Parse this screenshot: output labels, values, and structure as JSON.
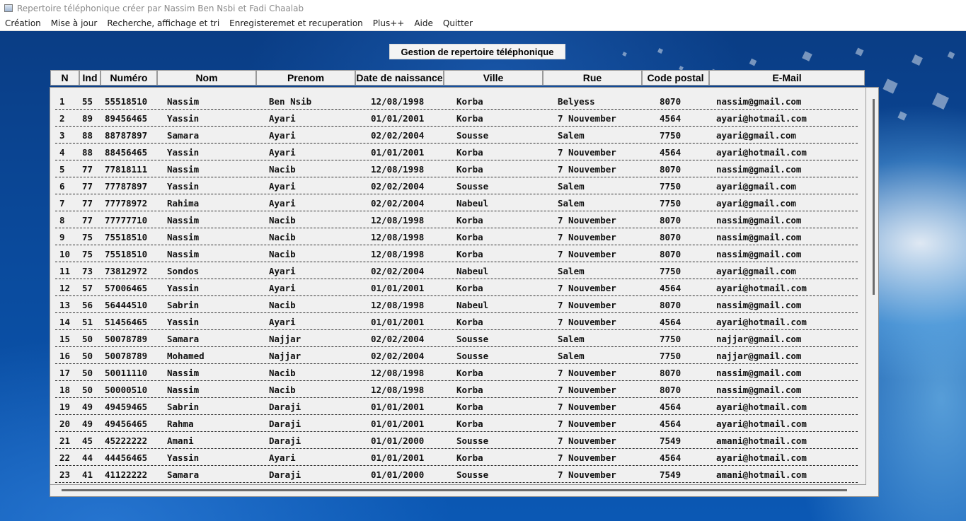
{
  "window": {
    "title": "Repertoire téléphonique créer par Nassim Ben Nsbi et Fadi Chaalab"
  },
  "menu": [
    "Création",
    "Mise à jour",
    "Recherche, affichage et tri",
    "Enregisteremet et recuperation",
    "Plus++",
    "Aide",
    "Quitter"
  ],
  "table_title": "Gestion de repertoire téléphonique",
  "columns": [
    "N",
    "Ind",
    "Numéro",
    "Nom",
    "Prenom",
    "Date de naissance",
    "Ville",
    "Rue",
    "Code postal",
    "E-Mail"
  ],
  "rows": [
    [
      "1",
      "55",
      "55518510",
      "Nassim",
      "Ben Nsib",
      "12/08/1998",
      "Korba",
      "Belyess",
      "8070",
      "nassim@gmail.com"
    ],
    [
      "2",
      "89",
      "89456465",
      "Yassin",
      "Ayari",
      "01/01/2001",
      "Korba",
      "7 Nouvember",
      "4564",
      "ayari@hotmail.com"
    ],
    [
      "3",
      "88",
      "88787897",
      "Samara",
      "Ayari",
      "02/02/2004",
      "Sousse",
      "Salem",
      "7750",
      "ayari@gmail.com"
    ],
    [
      "4",
      "88",
      "88456465",
      "Yassin",
      "Ayari",
      "01/01/2001",
      "Korba",
      "7 Nouvember",
      "4564",
      "ayari@hotmail.com"
    ],
    [
      "5",
      "77",
      "77818111",
      "Nassim",
      "Nacib",
      "12/08/1998",
      "Korba",
      "7 Nouvember",
      "8070",
      "nassim@gmail.com"
    ],
    [
      "6",
      "77",
      "77787897",
      "Yassin",
      "Ayari",
      "02/02/2004",
      "Sousse",
      "Salem",
      "7750",
      "ayari@gmail.com"
    ],
    [
      "7",
      "77",
      "77778972",
      "Rahima",
      "Ayari",
      "02/02/2004",
      "Nabeul",
      "Salem",
      "7750",
      "ayari@gmail.com"
    ],
    [
      "8",
      "77",
      "77777710",
      "Nassim",
      "Nacib",
      "12/08/1998",
      "Korba",
      "7 Nouvember",
      "8070",
      "nassim@gmail.com"
    ],
    [
      "9",
      "75",
      "75518510",
      "Nassim",
      "Nacib",
      "12/08/1998",
      "Korba",
      "7 Nouvember",
      "8070",
      "nassim@gmail.com"
    ],
    [
      "10",
      "75",
      "75518510",
      "Nassim",
      "Nacib",
      "12/08/1998",
      "Korba",
      "7 Nouvember",
      "8070",
      "nassim@gmail.com"
    ],
    [
      "11",
      "73",
      "73812972",
      "Sondos",
      "Ayari",
      "02/02/2004",
      "Nabeul",
      "Salem",
      "7750",
      "ayari@gmail.com"
    ],
    [
      "12",
      "57",
      "57006465",
      "Yassin",
      "Ayari",
      "01/01/2001",
      "Korba",
      "7 Nouvember",
      "4564",
      "ayari@hotmail.com"
    ],
    [
      "13",
      "56",
      "56444510",
      "Sabrin",
      "Nacib",
      "12/08/1998",
      "Nabeul",
      "7 Nouvember",
      "8070",
      "nassim@gmail.com"
    ],
    [
      "14",
      "51",
      "51456465",
      "Yassin",
      "Ayari",
      "01/01/2001",
      "Korba",
      "7 Nouvember",
      "4564",
      "ayari@hotmail.com"
    ],
    [
      "15",
      "50",
      "50078789",
      "Samara",
      "Najjar",
      "02/02/2004",
      "Sousse",
      "Salem",
      "7750",
      "najjar@gmail.com"
    ],
    [
      "16",
      "50",
      "50078789",
      "Mohamed",
      "Najjar",
      "02/02/2004",
      "Sousse",
      "Salem",
      "7750",
      "najjar@gmail.com"
    ],
    [
      "17",
      "50",
      "50011110",
      "Nassim",
      "Nacib",
      "12/08/1998",
      "Korba",
      "7 Nouvember",
      "8070",
      "nassim@gmail.com"
    ],
    [
      "18",
      "50",
      "50000510",
      "Nassim",
      "Nacib",
      "12/08/1998",
      "Korba",
      "7 Nouvember",
      "8070",
      "nassim@gmail.com"
    ],
    [
      "19",
      "49",
      "49459465",
      "Sabrin",
      "Daraji",
      "01/01/2001",
      "Korba",
      "7 Nouvember",
      "4564",
      "ayari@hotmail.com"
    ],
    [
      "20",
      "49",
      "49456465",
      "Rahma",
      "Daraji",
      "01/01/2001",
      "Korba",
      "7 Nouvember",
      "4564",
      "ayari@hotmail.com"
    ],
    [
      "21",
      "45",
      "45222222",
      "Amani",
      "Daraji",
      "01/01/2000",
      "Sousse",
      "7 Nouvember",
      "7549",
      "amani@hotmail.com"
    ],
    [
      "22",
      "44",
      "44456465",
      "Yassin",
      "Ayari",
      "01/01/2001",
      "Korba",
      "7 Nouvember",
      "4564",
      "ayari@hotmail.com"
    ],
    [
      "23",
      "41",
      "41122222",
      "Samara",
      "Daraji",
      "01/01/2000",
      "Sousse",
      "7 Nouvember",
      "7549",
      "amani@hotmail.com"
    ]
  ]
}
